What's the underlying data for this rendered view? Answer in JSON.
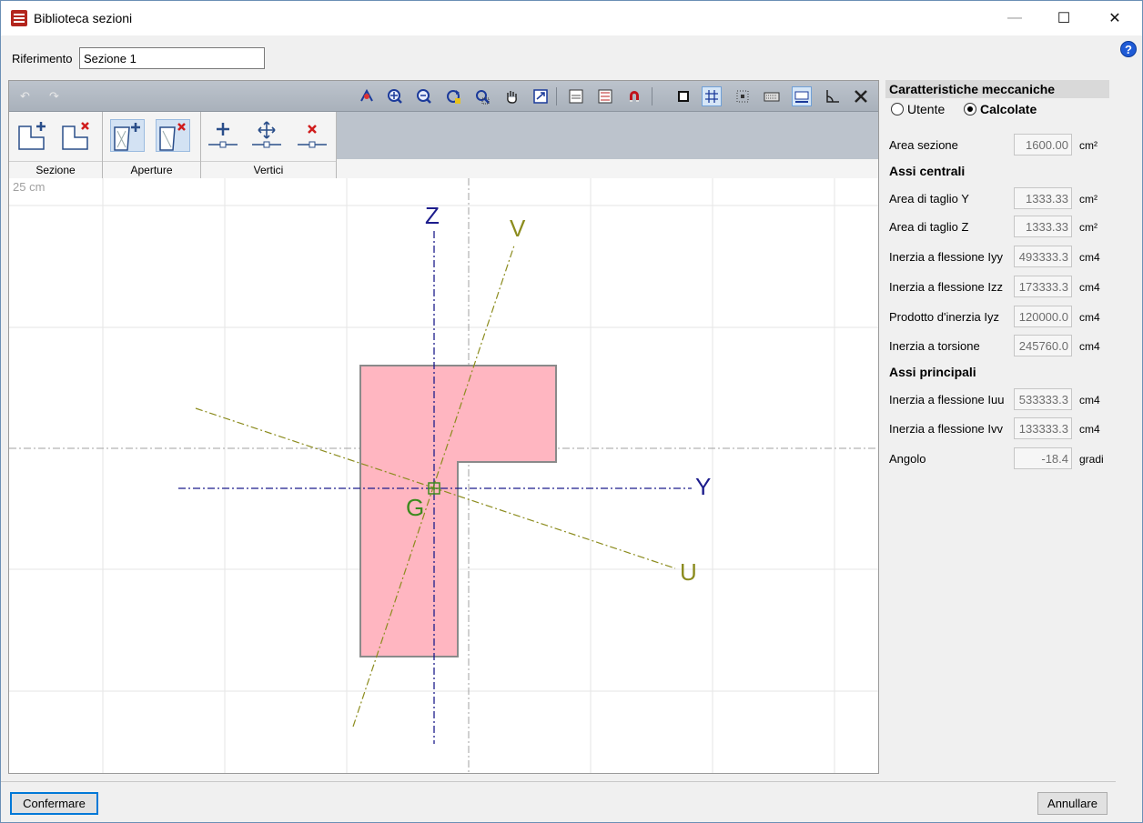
{
  "window": {
    "title": "Biblioteca sezioni",
    "minimize": "—",
    "maximize": "☐",
    "close": "✕",
    "help": "?"
  },
  "reference": {
    "label": "Riferimento",
    "value": "Sezione 1"
  },
  "toolbar": {
    "undo": "↶",
    "redo": "↷"
  },
  "ribbon": {
    "groups": [
      {
        "label": "Sezione"
      },
      {
        "label": "Aperture"
      },
      {
        "label": "Vertici"
      }
    ]
  },
  "canvas": {
    "scale_label": "25 cm",
    "axis_z": "Z",
    "axis_y": "Y",
    "axis_v": "V",
    "axis_u": "U",
    "centroid": "G",
    "section_fill": "#ffb6c1",
    "centroid_color": "#3c8a1e",
    "principal_color": "#8c8c1e",
    "central_color": "#1c1c8c"
  },
  "panel": {
    "title": "Caratteristiche meccaniche",
    "radio_user": "Utente",
    "radio_calc": "Calcolate",
    "area": {
      "label": "Area sezione",
      "value": "1600.00",
      "unit": "cm²"
    },
    "central_title": "Assi centrali",
    "central": [
      {
        "label": "Area di taglio Y",
        "value": "1333.33",
        "unit": "cm²"
      },
      {
        "label": "Area di taglio Z",
        "value": "1333.33",
        "unit": "cm²"
      },
      {
        "label": "Inerzia a flessione Iyy",
        "value": "493333.3",
        "unit": "cm4"
      },
      {
        "label": "Inerzia a flessione Izz",
        "value": "173333.3",
        "unit": "cm4"
      },
      {
        "label": "Prodotto d'inerzia Iyz",
        "value": "120000.0",
        "unit": "cm4"
      },
      {
        "label": "Inerzia a torsione",
        "value": "245760.0",
        "unit": "cm4"
      }
    ],
    "principal_title": "Assi principali",
    "principal": [
      {
        "label": "Inerzia a flessione Iuu",
        "value": "533333.3",
        "unit": "cm4"
      },
      {
        "label": "Inerzia a flessione Ivv",
        "value": "133333.3",
        "unit": "cm4"
      },
      {
        "label": "Angolo",
        "value": "-18.4",
        "unit": "gradi"
      }
    ]
  },
  "buttons": {
    "confirm": "Confermare",
    "cancel": "Annullare"
  }
}
